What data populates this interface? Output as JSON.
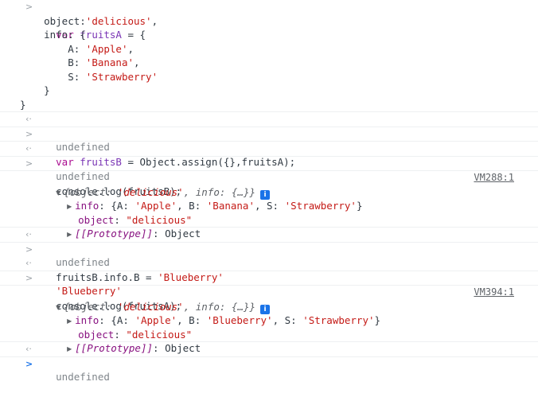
{
  "console": {
    "entries": [
      {
        "kind": "input",
        "lines": [
          {
            "text": "var fruitsA = {"
          },
          {
            "text": "    object:'delicious',"
          },
          {
            "text": "    info: {"
          },
          {
            "text": "        A: 'Apple',"
          },
          {
            "text": "        B: 'Banana',"
          },
          {
            "text": "        S: 'Strawberry'"
          },
          {
            "text": "    }"
          },
          {
            "text": "}"
          }
        ]
      },
      {
        "kind": "result",
        "text": "undefined"
      },
      {
        "kind": "input",
        "text": "var fruitsB = Object.assign({},fruitsA);"
      },
      {
        "kind": "result",
        "text": "undefined"
      },
      {
        "kind": "input",
        "text": "console.log(fruitsB);"
      },
      {
        "kind": "log",
        "summary_parts": [
          "{",
          "object",
          ": ",
          "'delicious'",
          ", ",
          "info",
          ": {…}}"
        ],
        "source": "VM288:1",
        "info_line": {
          "key": "info",
          "value_parts": [
            "{A: ",
            "'Apple'",
            ", B: ",
            "'Banana'",
            ", S: ",
            "'Strawberry'",
            "}"
          ]
        },
        "object_line": {
          "key": "object",
          "value": "\"delicious\""
        },
        "proto_line": {
          "key": "[[Prototype]]",
          "value": "Object"
        }
      },
      {
        "kind": "result",
        "text": "undefined"
      },
      {
        "kind": "input",
        "text": "fruitsB.info.B = 'Blueberry'"
      },
      {
        "kind": "result_str",
        "text": "'Blueberry'"
      },
      {
        "kind": "input",
        "text": "console.log(fruitsA);"
      },
      {
        "kind": "log",
        "summary_parts": [
          "{",
          "object",
          ": ",
          "'delicious'",
          ", ",
          "info",
          ": {…}}"
        ],
        "source": "VM394:1",
        "info_line": {
          "key": "info",
          "value_parts": [
            "{A: ",
            "'Apple'",
            ", B: ",
            "'Blueberry'",
            ", S: ",
            "'Strawberry'",
            "}"
          ]
        },
        "object_line": {
          "key": "object",
          "value": "\"delicious\""
        },
        "proto_line": {
          "key": "[[Prototype]]",
          "value": "Object"
        }
      },
      {
        "kind": "result",
        "text": "undefined"
      }
    ],
    "icons": {
      "input_prompt": "chevron-right-icon",
      "result_prompt": "return-arrow-icon",
      "expand": "triangle-right-icon",
      "collapse": "triangle-down-icon",
      "info": "info-badge-icon"
    },
    "colors": {
      "keyword": "#aa0d91",
      "string": "#c41a16",
      "accent": "#1a73e8",
      "muted": "#80868b"
    }
  }
}
